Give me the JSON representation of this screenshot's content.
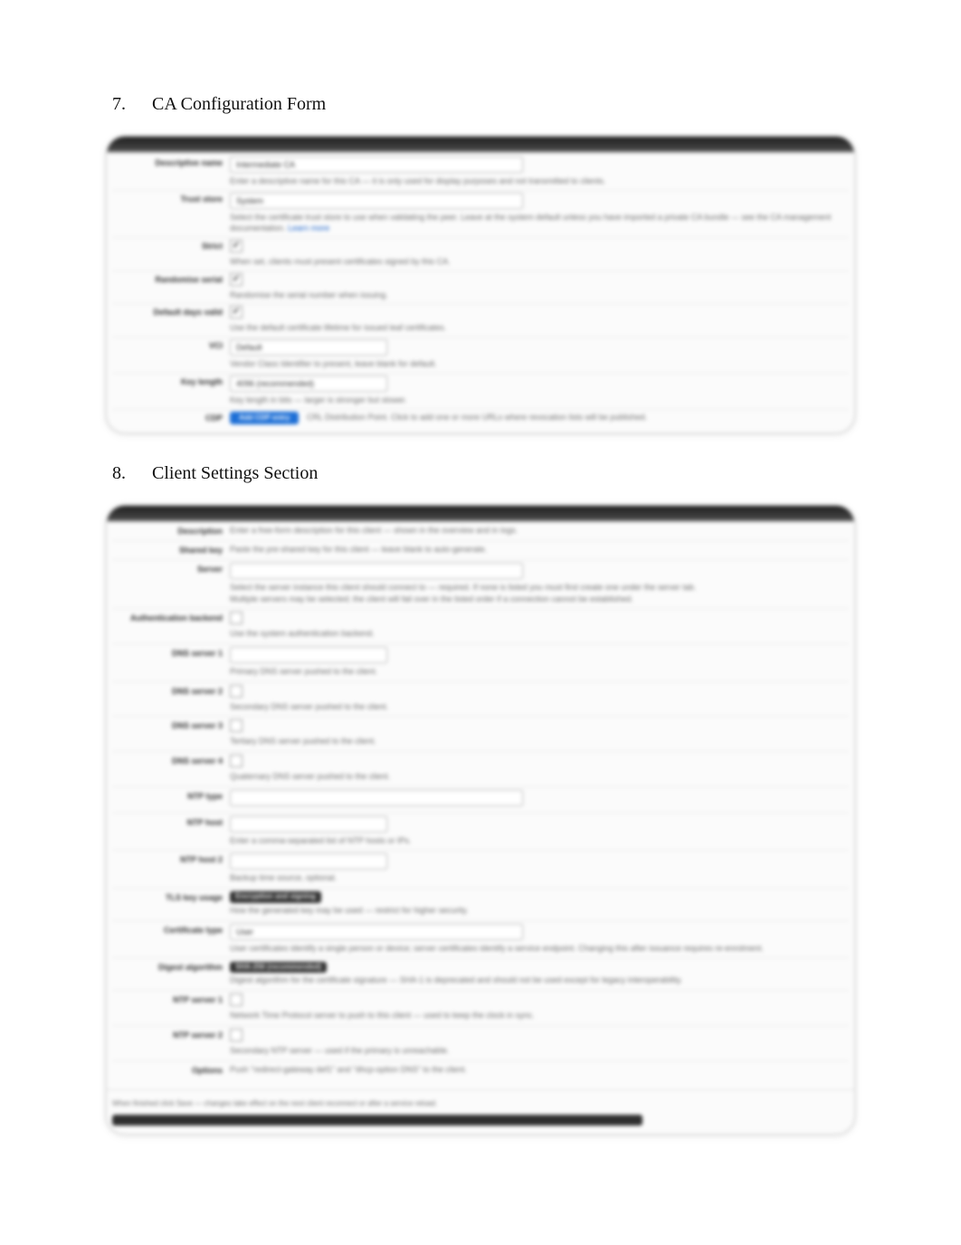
{
  "section7": {
    "num": "7.",
    "title": "CA Configuration Form",
    "rows": [
      {
        "label": "Descriptive name",
        "value_input": "Intermediate CA",
        "hint": "Enter a descriptive name for this CA — it is only used for display purposes and not transmitted to clients."
      },
      {
        "label": "Trust store",
        "value_input": "System",
        "select": true,
        "hint": "Select the certificate trust store to use when validating the peer. Leave at the system default unless you have imported a private CA bundle — see the CA management documentation."
      },
      {
        "label": "Strict",
        "checkbox": true,
        "checked": true,
        "hint": "When set, clients must present certificates signed by this CA."
      },
      {
        "label": "Randomise serial",
        "checkbox": true,
        "checked": true,
        "hint": "Randomise the serial number when issuing."
      },
      {
        "label": "Default days valid",
        "checkbox": true,
        "checked": true,
        "hint": "Use the default certificate lifetime for issued leaf certificates."
      },
      {
        "label": "VCI",
        "value_input": "Default",
        "hint": "Vendor Class Identifier to present, leave blank for default."
      },
      {
        "label": "Key length",
        "value_input": "4096 (recommended)",
        "hint": "Key length in bits — larger is stronger but slower."
      },
      {
        "label": "CDP",
        "button": "Add CDP entry",
        "hint": "CRL Distribution Point. Click to add one or more URLs where revocation lists will be published."
      }
    ]
  },
  "section8": {
    "num": "8.",
    "title": "Client Settings Section",
    "rows": [
      {
        "label": "Description",
        "hint_only": "Enter a free-form description for this client — shown in the overview and in logs."
      },
      {
        "label": "Shared key",
        "hint_only": "Paste the pre-shared key for this client — leave blank to auto-generate."
      },
      {
        "label": "Server",
        "value_input": "",
        "select": true,
        "hint": "Select the server instance this client should connect to — required. If none is listed you must first create one under the server tab.",
        "hint2": "Multiple servers may be selected; the client will fail over in the listed order if a connection cannot be established."
      },
      {
        "label": "Authentication backend",
        "checkbox": true,
        "checked": false,
        "hint": "Use the system authentication backend."
      },
      {
        "label": "DNS server 1",
        "value_input": "",
        "hint": "Primary DNS server pushed to the client."
      },
      {
        "label": "DNS server 2",
        "checkbox": true,
        "checked": false,
        "hint": "Secondary DNS server pushed to the client."
      },
      {
        "label": "DNS server 3",
        "checkbox": true,
        "checked": false,
        "hint": "Tertiary DNS server pushed to the client."
      },
      {
        "label": "DNS server 4",
        "checkbox": true,
        "checked": false,
        "hint": "Quaternary DNS server pushed to the client."
      },
      {
        "label": "NTP type",
        "value_input": "",
        "hint": ""
      },
      {
        "label": "NTP host",
        "value_input": "",
        "hint": "Enter a comma-separated list of NTP hosts or IPs."
      },
      {
        "label": "NTP host 2",
        "value_input": "",
        "hint": "Backup time source, optional."
      },
      {
        "label": "TLS key usage",
        "pill": "Encryption and signing",
        "hint": "How the generated key may be used — restrict for higher security."
      },
      {
        "label": "Certificate type",
        "value_input": "User",
        "select": true,
        "hint": "User certificates identify a single person or device; server certificates identify a service endpoint. Changing this after issuance requires re-enrolment."
      },
      {
        "label": "Digest algorithm",
        "pill": "SHA-256 (recommended)",
        "hint": "Digest algorithm for the certificate signature — SHA-1 is deprecated and should not be used except for legacy interoperability."
      },
      {
        "label": "NTP server 1",
        "checkbox": true,
        "checked": false,
        "hint": "Network Time Protocol server to push to this client — used to keep the clock in sync."
      },
      {
        "label": "NTP server 2",
        "checkbox": true,
        "checked": false,
        "hint": "Secondary NTP server — used if the primary is unreachable."
      },
      {
        "label": "Options",
        "tiny": "Push \"redirect-gateway def1\" and \"dhcp-option DNS\" to the client.",
        "hint": ""
      }
    ],
    "footer_hint": "When finished click Save — changes take effect on the next client reconnect or after a service reload."
  }
}
